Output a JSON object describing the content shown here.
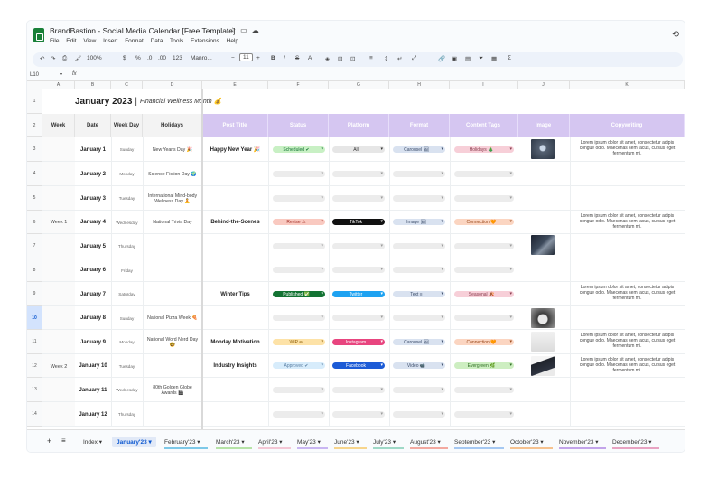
{
  "title": "BrandBastion - Social Media Calendar [Free Template]",
  "menu": [
    "File",
    "Edit",
    "View",
    "Insert",
    "Format",
    "Data",
    "Tools",
    "Extensions",
    "Help"
  ],
  "toolbar": {
    "zoom": "100%",
    "currency": "$",
    "percent": "%",
    "dec_dec": ".0",
    "dec_inc": ".00",
    "format_123": "123",
    "font": "Manro...",
    "font_size": "11"
  },
  "name_box": "L10",
  "fx": "fx",
  "columns": [
    "A",
    "B",
    "C",
    "D",
    "E",
    "F",
    "G",
    "H",
    "I",
    "J",
    "K"
  ],
  "row_numbers": [
    "1",
    "2",
    "3",
    "4",
    "5",
    "6",
    "7",
    "8",
    "9",
    "10",
    "11",
    "12",
    "13",
    "14"
  ],
  "banner": {
    "title": "January 2023",
    "separator": "|",
    "subtitle": "Financial Wellness Month 💰"
  },
  "headers": {
    "week": "Week",
    "date": "Date",
    "weekday": "Week Day",
    "holidays": "Holidays",
    "post_title": "Post Title",
    "status": "Status",
    "platform": "Platform",
    "format": "Format",
    "content_tags": "Content Tags",
    "image": "Image",
    "copywriting": "Copywriting"
  },
  "weeks": [
    "Week 1",
    "Week 2"
  ],
  "rows": [
    {
      "date": "January 1",
      "weekday": "Sunday",
      "holiday": "New Year's Day 🎉",
      "post": "Happy New Year 🎉",
      "status": "Scheduled ✔",
      "platform": "All",
      "format": "Carousel 🖼",
      "tag": "Holidays 🎄",
      "copy": [
        "Lorem ipsum dolor sit amet, consectetur adipis",
        "congue odio. Maecenas sem lacus, cursus eget",
        "fermentum mi."
      ]
    },
    {
      "date": "January 2",
      "weekday": "Monday",
      "holiday": "Science Fiction Day 🌍",
      "post": "",
      "status": "",
      "platform": "",
      "format": "",
      "tag": "",
      "copy": []
    },
    {
      "date": "January 3",
      "weekday": "Tuesday",
      "holiday": "International Mind-body Wellness Day 🧘",
      "post": "",
      "status": "",
      "platform": "",
      "format": "",
      "tag": "",
      "copy": []
    },
    {
      "date": "January 4",
      "weekday": "Wednesday",
      "holiday": "National Trivia Day",
      "post": "Behind-the-Scenes",
      "status": "Revise ⚠",
      "platform": "TikTok",
      "format": "Image 🖼",
      "tag": "Connection 🧡",
      "copy": [
        "Lorem ipsum dolor sit amet, consectetur adipis",
        "congue odio. Maecenas sem lacus, cursus eget",
        "fermentum mi."
      ]
    },
    {
      "date": "January 5",
      "weekday": "Thursday",
      "holiday": "",
      "post": "",
      "status": "",
      "platform": "",
      "format": "",
      "tag": "",
      "copy": []
    },
    {
      "date": "January 6",
      "weekday": "Friday",
      "holiday": "",
      "post": "",
      "status": "",
      "platform": "",
      "format": "",
      "tag": "",
      "copy": []
    },
    {
      "date": "January 7",
      "weekday": "Saturday",
      "holiday": "",
      "post": "Winter Tips",
      "status": "Published ✅",
      "platform": "Twitter",
      "format": "Text ≡",
      "tag": "Seasonal 🍂",
      "copy": [
        "Lorem ipsum dolor sit amet, consectetur adipis",
        "congue odio. Maecenas sem lacus, cursus eget",
        "fermentum mi."
      ]
    },
    {
      "date": "January 8",
      "weekday": "Sunday",
      "holiday": "National Pizza Week 🍕",
      "post": "",
      "status": "",
      "platform": "",
      "format": "",
      "tag": "",
      "copy": []
    },
    {
      "date": "January 9",
      "weekday": "Monday",
      "holiday": "National Word Nerd Day 🤓",
      "post": "Monday Motivation",
      "status": "WIP ✏",
      "platform": "Instagram",
      "format": "Carousel 🖼",
      "tag": "Connection 🧡",
      "copy": [
        "Lorem ipsum dolor sit amet, consectetur adipis",
        "congue odio. Maecenas sem lacus, cursus eget",
        "fermentum mi."
      ]
    },
    {
      "date": "January 10",
      "weekday": "Tuesday",
      "holiday": "",
      "post": "Industry Insights",
      "status": "Approved ✔",
      "platform": "Facebook",
      "format": "Video 📹",
      "tag": "Evergreen 🌿",
      "copy": [
        "Lorem ipsum dolor sit amet, consectetur adipis",
        "congue odio. Maecenas sem lacus, cursus eget",
        "fermentum mi."
      ]
    },
    {
      "date": "January 11",
      "weekday": "Wednesday",
      "holiday": "80th Golden Globe Awards 🎬",
      "post": "",
      "status": "",
      "platform": "",
      "format": "",
      "tag": "",
      "copy": []
    },
    {
      "date": "January 12",
      "weekday": "Thursday",
      "holiday": "",
      "post": "",
      "status": "",
      "platform": "",
      "format": "",
      "tag": "",
      "copy": []
    }
  ],
  "sheet_tabs": [
    "Index",
    "January'23",
    "February'23",
    "March'23",
    "April'23",
    "May'23",
    "June'23",
    "July'23",
    "August'23",
    "September'23",
    "October'23",
    "November'23",
    "December'23"
  ],
  "colors": {
    "header_purple": "#d5c6f1",
    "scheduled": "#c8f0c4",
    "revise": "#f9c9c0",
    "published": "#137333",
    "wip": "#fde2a7",
    "approved": "#d7ecfb",
    "all": "#e6e6e6",
    "tiktok": "#111111",
    "twitter": "#1ea2f1",
    "instagram": "#e8457f",
    "facebook": "#1c5bd6",
    "format": "#d9e2f0",
    "connection": "#fbd5c1",
    "holidays": "#f7cfd8",
    "seasonal": "#f7cfd8",
    "evergreen": "#cdeec1"
  }
}
